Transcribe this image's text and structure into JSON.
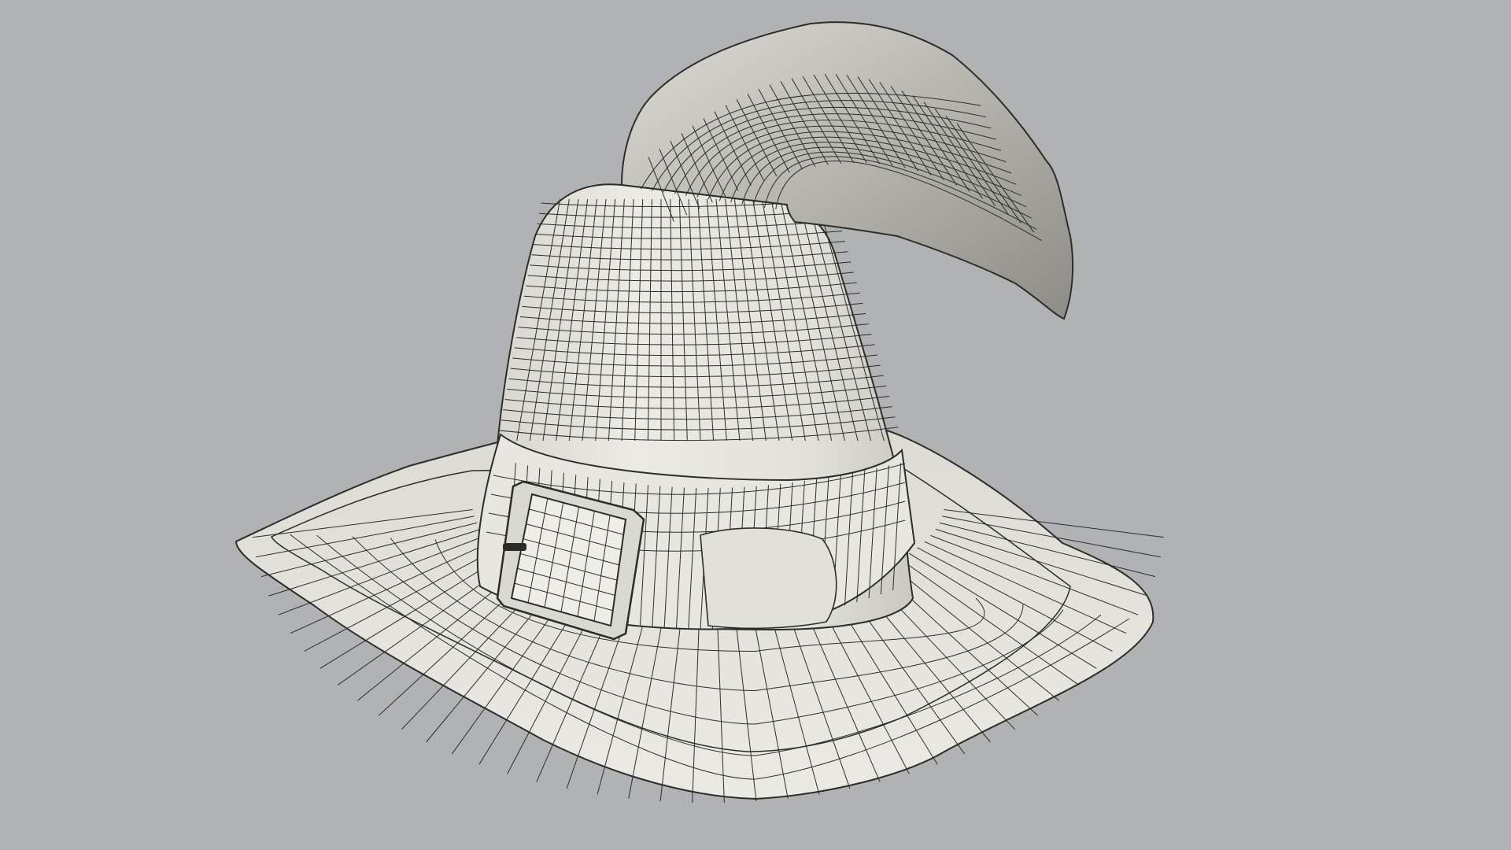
{
  "scene": {
    "subject": "witch-hat-wireframe-render",
    "colors": {
      "background": "#b1b2b4",
      "surface": "#e6e5df",
      "surface_shade": "#cfcec7",
      "wire": "#2b2e28"
    }
  }
}
